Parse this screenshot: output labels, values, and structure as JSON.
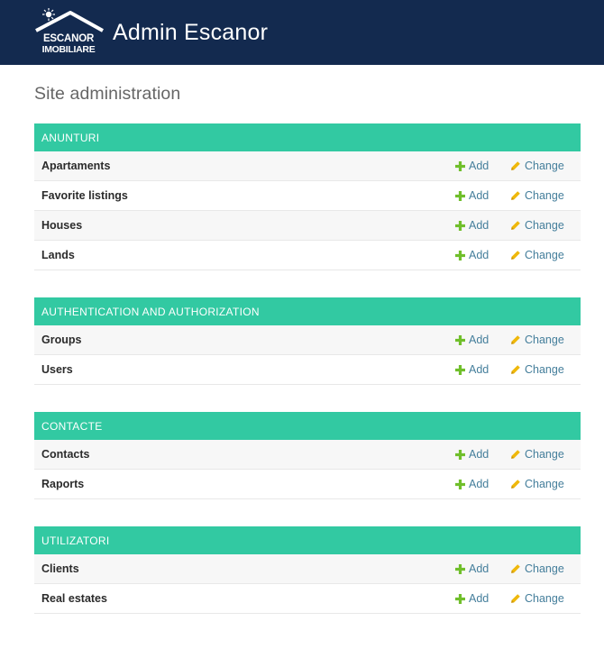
{
  "header": {
    "logo_line1": "ESCANOR",
    "logo_line2": "IMOBILIARE",
    "brand": "Admin Escanor"
  },
  "page": {
    "title": "Site administration"
  },
  "colors": {
    "header_bg": "#132a4f",
    "caption_bg": "#32c9a2",
    "add_icon": "#70bf2b",
    "change_icon": "#efb80b"
  },
  "icons": {
    "add": "plus-icon",
    "change": "pencil-icon"
  },
  "actions": {
    "add_label": "Add",
    "change_label": "Change"
  },
  "modules": [
    {
      "caption": "ANUNTURI",
      "models": [
        "Apartaments",
        "Favorite listings",
        "Houses",
        "Lands"
      ]
    },
    {
      "caption": "AUTHENTICATION AND AUTHORIZATION",
      "models": [
        "Groups",
        "Users"
      ]
    },
    {
      "caption": "CONTACTE",
      "models": [
        "Contacts",
        "Raports"
      ]
    },
    {
      "caption": "UTILIZATORI",
      "models": [
        "Clients",
        "Real estates"
      ]
    }
  ]
}
